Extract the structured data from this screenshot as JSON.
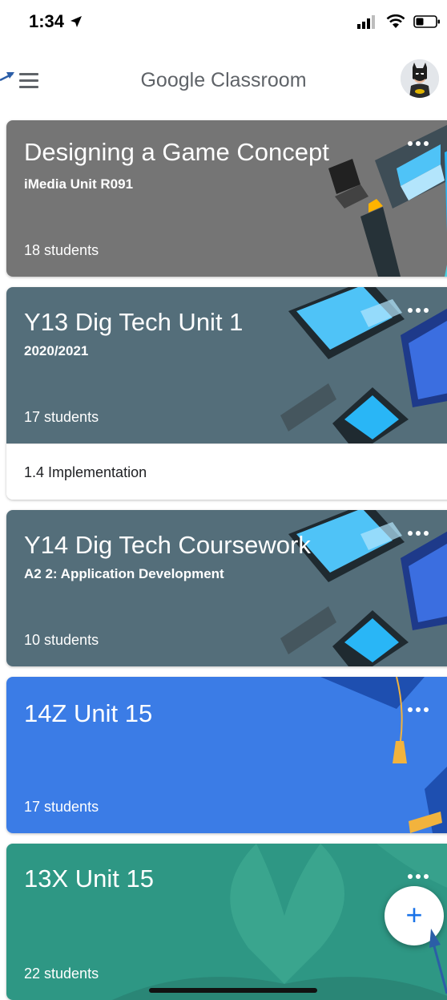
{
  "status_bar": {
    "time": "1:34",
    "location_icon": "location-arrow-icon"
  },
  "app_bar": {
    "title": "Google Classroom",
    "menu_icon": "hamburger-menu-icon",
    "avatar_icon": "batman-avatar-icon"
  },
  "courses": [
    {
      "title": "Designing a Game Concept",
      "subtitle": "iMedia Unit R091",
      "students": "18 students",
      "color": "#757575",
      "footer": ""
    },
    {
      "title": "Y13 Dig Tech Unit 1",
      "subtitle": "2020/2021",
      "students": "17 students",
      "color": "#546e7a",
      "footer": "1.4 Implementation"
    },
    {
      "title": "Y14 Dig Tech Coursework",
      "subtitle": "A2 2: Application Development",
      "students": "10 students",
      "color": "#546e7a",
      "footer": ""
    },
    {
      "title": "14Z Unit 15",
      "subtitle": "",
      "students": "17 students",
      "color": "#3b7ce6",
      "footer": ""
    },
    {
      "title": "13X Unit 15",
      "subtitle": "",
      "students": "22 students",
      "color": "#2e9784",
      "footer": ""
    }
  ],
  "fab": {
    "label": "+",
    "icon": "plus-icon"
  },
  "colors": {
    "accent": "#1a73e8",
    "annotation": "#2b5ea7"
  }
}
